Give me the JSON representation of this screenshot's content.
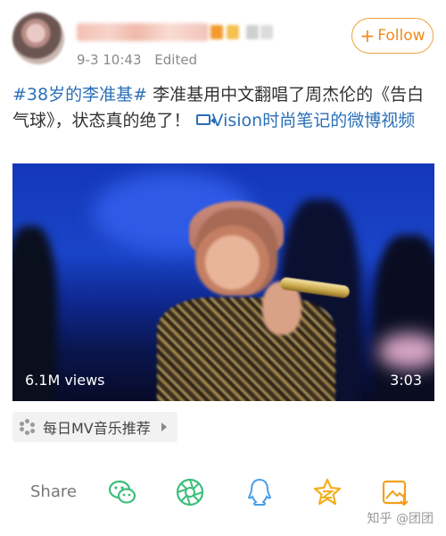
{
  "post": {
    "meta": {
      "time": "9-3 10:43",
      "status": "Edited"
    },
    "follow_label": "Follow",
    "follow_plus": "+",
    "text": {
      "hashtag": "#38岁的李准基#",
      "body": " 李准基用中文翻唱了周杰伦的《告白气球》，状态真的绝了！",
      "video_link": "Vision时尚笔记的微博视频"
    }
  },
  "video": {
    "views": "6.1M views",
    "duration": "3:03"
  },
  "source_tag": {
    "label": "每日MV音乐推荐"
  },
  "actions": {
    "share_label": "Share"
  },
  "watermark": "知乎 @团团",
  "colors": {
    "accent": "#f08a1c",
    "link": "#2a6fb8",
    "icon_green": "#3cbf7a",
    "icon_blue": "#4a9ee8",
    "icon_gold": "#f2b01e"
  },
  "icons": [
    "wechat-icon",
    "moments-icon",
    "qq-icon",
    "qzone-icon",
    "save-image-icon"
  ]
}
